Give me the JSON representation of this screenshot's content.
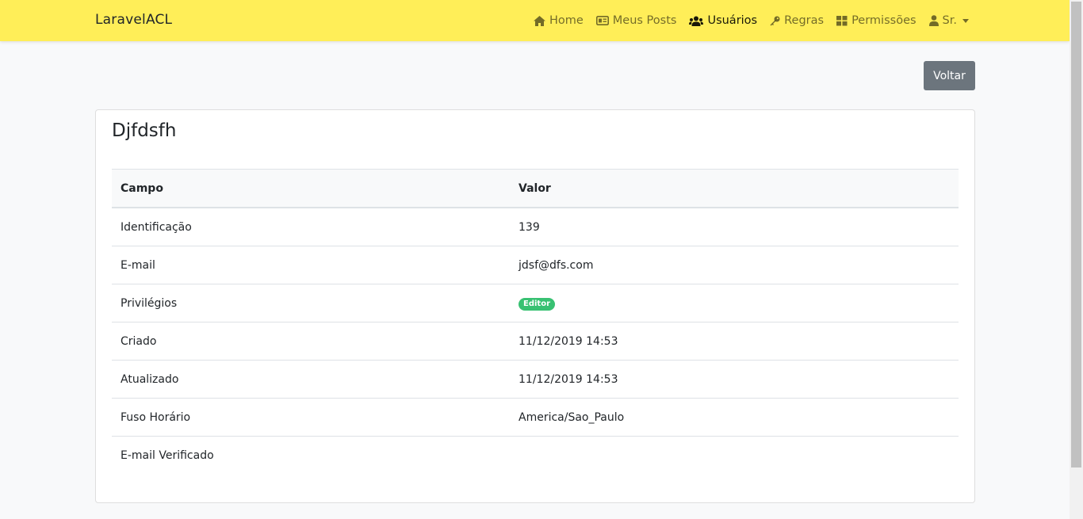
{
  "navbar": {
    "brand": "LaravelACL",
    "items": [
      {
        "label": "Home",
        "icon": "home-icon"
      },
      {
        "label": "Meus Posts",
        "icon": "posts-icon"
      },
      {
        "label": "Usuários",
        "icon": "users-icon"
      },
      {
        "label": "Regras",
        "icon": "key-icon"
      },
      {
        "label": "Permissões",
        "icon": "grid-icon"
      },
      {
        "label": "Sr.",
        "icon": "user-icon"
      }
    ]
  },
  "actions": {
    "back_label": "Voltar"
  },
  "card": {
    "title": "Djfdsfh",
    "table": {
      "headers": [
        "Campo",
        "Valor"
      ],
      "rows": [
        {
          "field": "Identificação",
          "value": "139"
        },
        {
          "field": "E-mail",
          "value": "jdsf@dfs.com"
        },
        {
          "field": "Privilégios",
          "badge": "Editor"
        },
        {
          "field": "Criado",
          "value": "11/12/2019 14:53"
        },
        {
          "field": "Atualizado",
          "value": "11/12/2019 14:53"
        },
        {
          "field": "Fuso Horário",
          "value": "America/Sao_Paulo"
        },
        {
          "field": "E-mail Verificado",
          "value": ""
        }
      ]
    }
  },
  "colors": {
    "navbar_bg": "#ffee58",
    "badge_bg": "#38c172",
    "button_bg": "#6c757d"
  }
}
